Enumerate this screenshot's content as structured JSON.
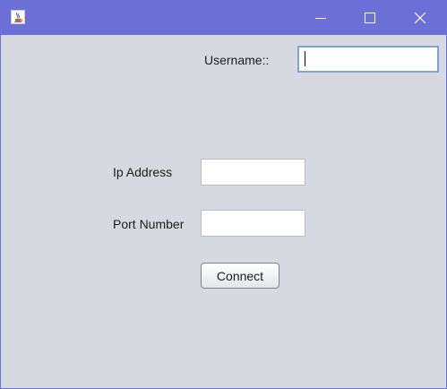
{
  "window": {
    "title": "",
    "icon": "java-cup-icon",
    "titlebar_color": "#6b6fd6",
    "background_color": "#d6d9df",
    "controls": {
      "minimize": "minimize-icon",
      "maximize": "maximize-icon",
      "close": "close-icon"
    }
  },
  "form": {
    "username": {
      "label": "Username::",
      "value": ""
    },
    "ip_address": {
      "label": "Ip Address",
      "value": ""
    },
    "port_number": {
      "label": "Port Number",
      "value": ""
    },
    "connect_button": {
      "label": "Connect"
    }
  }
}
